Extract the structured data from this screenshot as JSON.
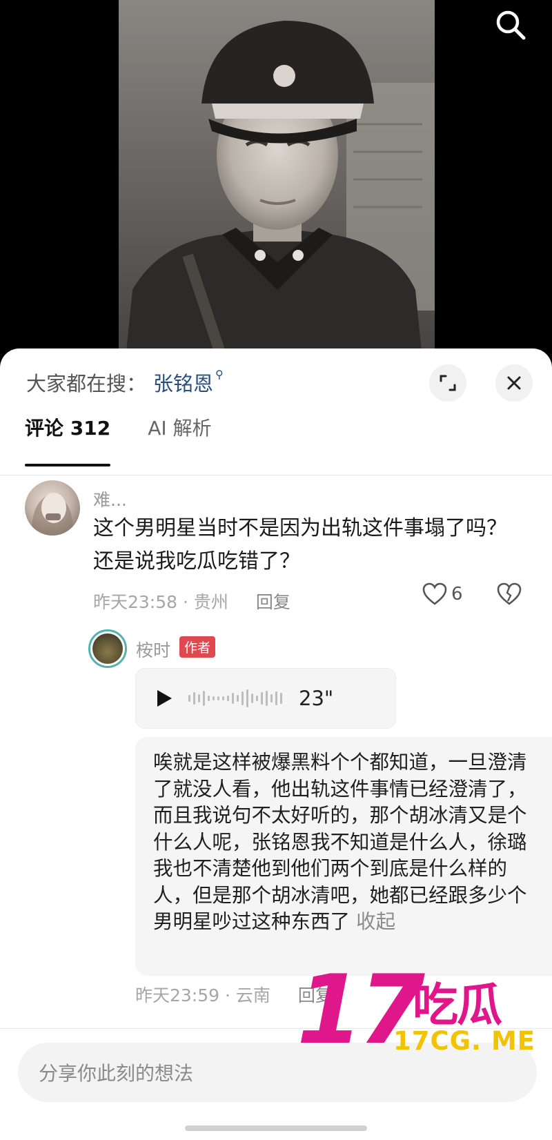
{
  "photo": {
    "alt_icon": "portrait-photo"
  },
  "top_bar": {
    "search_icon": "search-icon"
  },
  "sheet": {
    "search_hint_label": "大家都在搜：",
    "search_hint_term": "张铭恩",
    "expand_icon": "expand-icon",
    "close_icon": "close-icon"
  },
  "tabs": [
    {
      "label": "评论 312",
      "active": true
    },
    {
      "label": "AI 解析",
      "active": false
    }
  ],
  "comment": {
    "username": "难...",
    "text": "这个男明星当时不是因为出轨这件事塌了吗？还是说我吃瓜吃错了？",
    "time_location": "昨天23:58 · 贵州",
    "reply_label": "回复",
    "likes": "6"
  },
  "reply": {
    "username": "桉时",
    "tag": "作者",
    "voice_duration": "23\"",
    "transcript": "唉就是这样被爆黑料个个都知道，一旦澄清了就没人看，他出轨这件事情已经澄清了，而且我说句不太好听的，那个胡冰清又是个什么人呢，张铭恩我不知道是什么人，徐璐我也不清楚他到他们两个到底是什么样的人，但是那个胡冰清吧，她都已经跟多少个男明星吵过这种东西了",
    "collapse_label": "收起",
    "time_location": "昨天23:59 · 云南",
    "reply_label": "回复"
  },
  "input": {
    "placeholder": "分享你此刻的想法"
  },
  "watermark": {
    "number": "17",
    "chinese": "吃瓜",
    "url": "17CG. ME"
  },
  "colors": {
    "accent_link": "#2a4f7e",
    "author_tag": "#e0484f",
    "watermark_pink": "#e0168b",
    "watermark_yellow": "#f2c300"
  }
}
